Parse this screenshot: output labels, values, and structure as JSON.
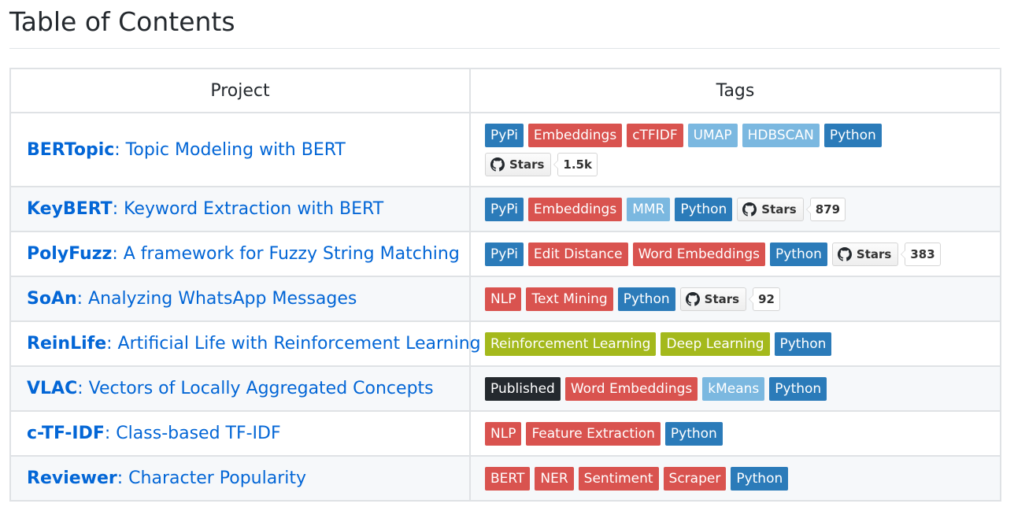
{
  "title": "Table of Contents",
  "headers": {
    "project": "Project",
    "tags": "Tags"
  },
  "colors": {
    "PyPi": "#2b7bb9",
    "Python": "#2b7bb9",
    "Embeddings": "#d9534f",
    "cTFIDF": "#d9534f",
    "Edit Distance": "#d9534f",
    "Word Embeddings": "#d9534f",
    "NLP": "#d9534f",
    "Text Mining": "#d9534f",
    "Feature Extraction": "#d9534f",
    "BERT": "#d9534f",
    "NER": "#d9534f",
    "Sentiment": "#d9534f",
    "Scraper": "#d9534f",
    "UMAP": "#7bb8e0",
    "HDBSCAN": "#7bb8e0",
    "MMR": "#7bb8e0",
    "kMeans": "#7bb8e0",
    "Reinforcement Learning": "#a4b91c",
    "Deep Learning": "#a4b91c",
    "Published": "#24292e"
  },
  "rows": [
    {
      "name": "BERTopic",
      "desc": ": Topic Modeling with BERT",
      "tags": [
        "PyPi",
        "Embeddings",
        "cTFIDF",
        "UMAP",
        "HDBSCAN",
        "Python"
      ],
      "stars": {
        "label": "Stars",
        "count": "1.5k"
      }
    },
    {
      "name": "KeyBERT",
      "desc": ": Keyword Extraction with BERT",
      "tags": [
        "PyPi",
        "Embeddings",
        "MMR",
        "Python"
      ],
      "stars": {
        "label": "Stars",
        "count": "879"
      }
    },
    {
      "name": "PolyFuzz",
      "desc": ": A framework for Fuzzy String Matching",
      "tags": [
        "PyPi",
        "Edit Distance",
        "Word Embeddings",
        "Python"
      ],
      "stars": {
        "label": "Stars",
        "count": "383"
      }
    },
    {
      "name": "SoAn",
      "desc": ": Analyzing WhatsApp Messages",
      "tags": [
        "NLP",
        "Text Mining",
        "Python"
      ],
      "stars": {
        "label": "Stars",
        "count": "92"
      }
    },
    {
      "name": "ReinLife",
      "desc": ": Artificial Life with Reinforcement Learning",
      "tags": [
        "Reinforcement Learning",
        "Deep Learning",
        "Python"
      ]
    },
    {
      "name": "VLAC",
      "desc": ": Vectors of Locally Aggregated Concepts",
      "tags": [
        "Published",
        "Word Embeddings",
        "kMeans",
        "Python"
      ]
    },
    {
      "name": "c-TF-IDF",
      "desc": ": Class-based TF-IDF",
      "tags": [
        "NLP",
        "Feature Extraction",
        "Python"
      ]
    },
    {
      "name": "Reviewer",
      "desc": ": Character Popularity",
      "tags": [
        "BERT",
        "NER",
        "Sentiment",
        "Scraper",
        "Python"
      ]
    }
  ]
}
